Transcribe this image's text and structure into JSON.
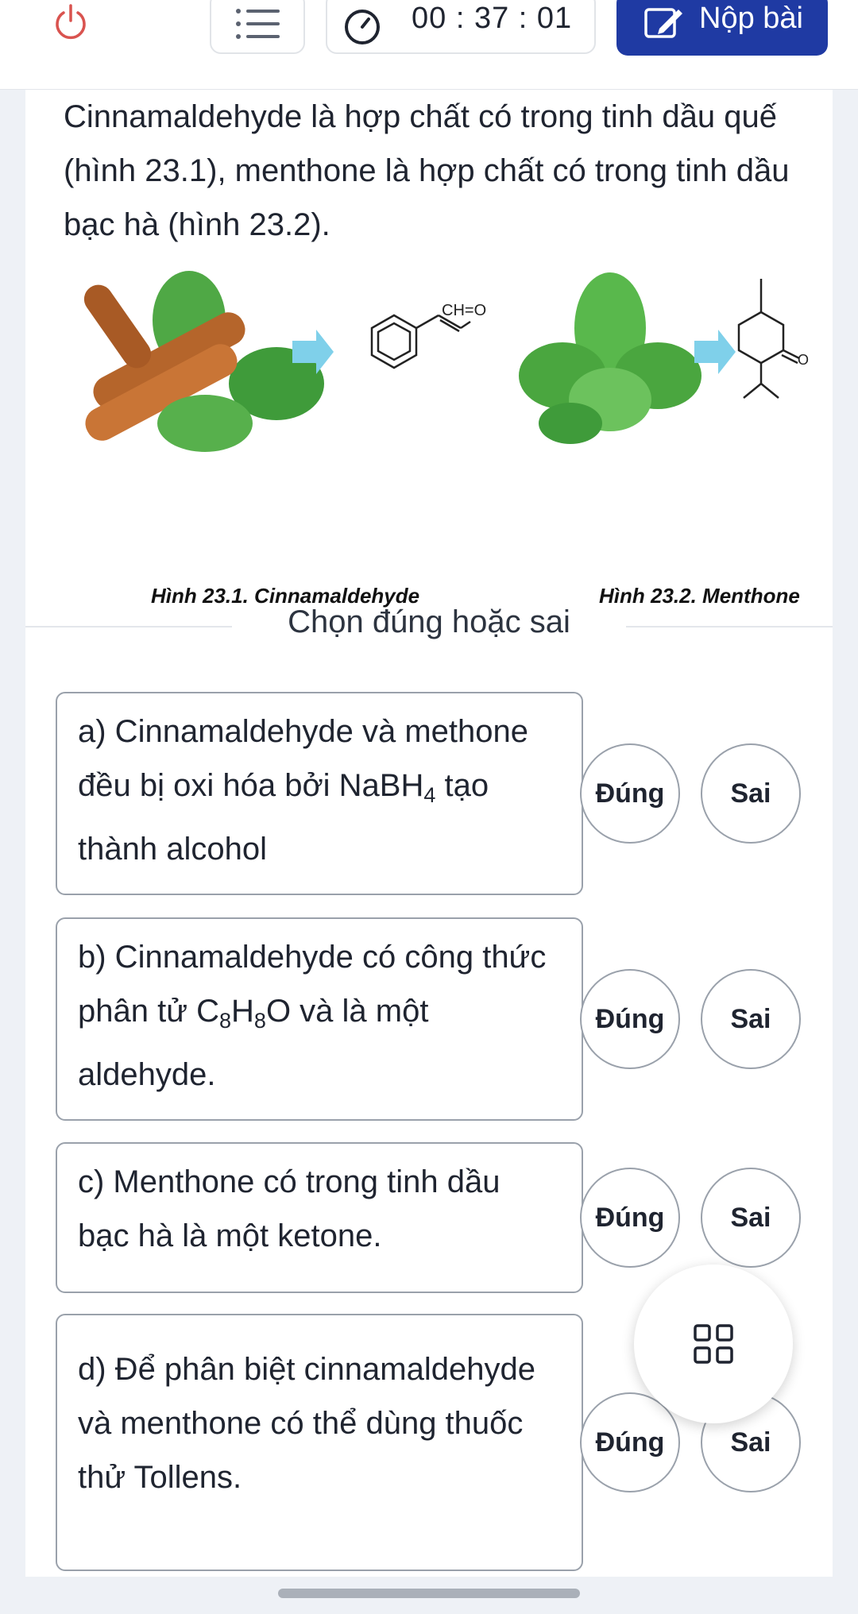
{
  "topbar": {
    "timer": "00 : 37 : 01",
    "submit_label": "Nộp bài",
    "icons": [
      "power-icon",
      "menu-icon",
      "clock-icon",
      "edit-icon"
    ]
  },
  "question": {
    "text": "Cinnamaldehyde là hợp chất có trong tinh dầu quế (hình 23.1), menthone là hợp chất có trong tinh dầu bạc hà (hình 23.2).",
    "figure_left_caption": "Hình 23.1. Cinnamaldehyde",
    "figure_right_caption": "Hình 23.2. Menthone",
    "formula_label": "CH=O",
    "oxygen_label": "O"
  },
  "section_title": "Chọn đúng hoặc sai",
  "items": [
    {
      "pre": "a) Cinnamaldehyde và methone đều bị oxi hóa bởi NaBH",
      "sub": "4",
      "post": " tạo thành alcohol",
      "true_label": "Đúng",
      "false_label": "Sai"
    },
    {
      "pre": "b) Cinnamaldehyde có công thức phân tử C",
      "sub1": "8",
      "mid": "H",
      "sub2": "8",
      "post": "O và là một aldehyde.",
      "true_label": "Đúng",
      "false_label": "Sai"
    },
    {
      "text": "c) Menthone có trong tinh dầu bạc hà là một ketone.",
      "true_label": "Đúng",
      "false_label": "Sai"
    },
    {
      "text": "d) Để phân biệt cinnamaldehyde và menthone có thể dùng thuốc thử Tollens.",
      "true_label": "Đúng",
      "false_label": "Sai"
    }
  ],
  "colors": {
    "accent": "#1f3aa3",
    "cinnamon": "#b5652b",
    "leaf": "#3f9b3a",
    "arrow": "#7fd0ea"
  }
}
